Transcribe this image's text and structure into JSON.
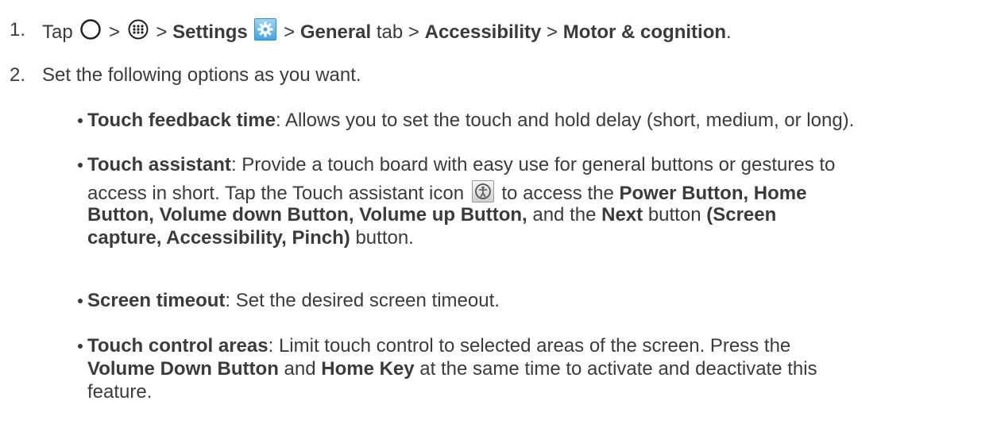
{
  "step1": {
    "num": "1.",
    "tap": "Tap",
    "sep": ">",
    "settings": "Settings",
    "general": "General",
    "tab": "tab",
    "accessibility": "Accessibility",
    "motor": "Motor & cognition",
    "end": "."
  },
  "step2": {
    "num": "2.",
    "text": "Set the following options as you want."
  },
  "bullets": {
    "b1": {
      "title": "Touch feedback time",
      "text": ": Allows you to set the touch and hold delay (short, medium, or long)."
    },
    "b2": {
      "title": "Touch assistant",
      "text1": ": Provide a touch board with easy use for general buttons or gestures to",
      "text2": "access in short. Tap the Touch assistant icon",
      "text3": "to access the",
      "power": "Power Button, Home",
      "line3": "Button, Volume down Button, Volume up Button,",
      "and_the": "and the",
      "next": "Next",
      "button": "button",
      "screen": "(Screen",
      "line4": "capture, Accessibility, Pinch)",
      "button2": "button."
    },
    "b3": {
      "title": "Screen timeout",
      "text": ": Set the desired screen timeout."
    },
    "b4": {
      "title": "Touch control areas",
      "text1": ": Limit touch control to selected areas of the screen. Press the",
      "vdb": "Volume Down Button",
      "and": "and",
      "home": "Home Key",
      "text2": "at the same time to activate and deactivate this",
      "text3": "feature."
    }
  },
  "icons": {
    "home": "home-circle-icon",
    "apps": "apps-icon",
    "settings": "settings-gear-icon",
    "touch_assistant": "touch-assistant-icon"
  }
}
